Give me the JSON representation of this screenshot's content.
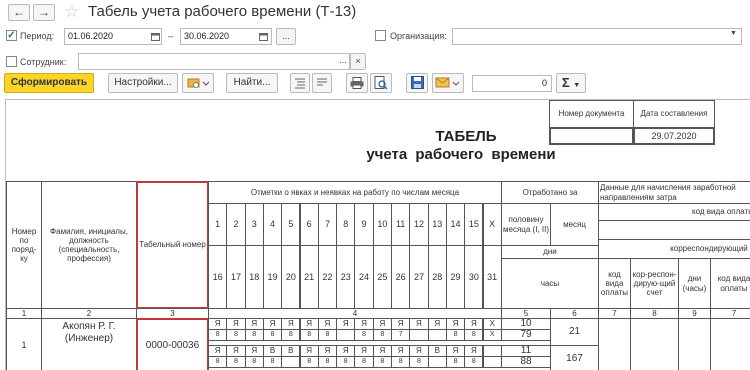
{
  "window": {
    "title": "Табель учета рабочего времени (Т-13)",
    "back_icon": "←",
    "forward_icon": "→",
    "star_icon": "☆"
  },
  "filters": {
    "period_label": "Период:",
    "period_checked": "✓",
    "date_from": "01.06.2020",
    "date_sep": "–",
    "date_to": "30.06.2020",
    "ellipsis": "...",
    "org_label": "Организация:",
    "employees_label": "Сотрудник:",
    "clear_icon": "×"
  },
  "actions": {
    "generate": "Сформировать",
    "settings": "Настройки...",
    "find": "Найти...",
    "counter": "0",
    "sum_icon": "Σ"
  },
  "report": {
    "doc_number_header": "Номер документа",
    "doc_date_header": "Дата составления",
    "doc_date": "29.07.2020",
    "title_line1": "ТАБЕЛЬ",
    "title_line2": "учета рабочего времени",
    "col_num": "Номер по поряд-ку",
    "col_name": "Фамилия, инициалы, должность (специальность, профессия)",
    "col_tab": "Табельный номер",
    "col_marks": "Отметки о явках и неявках на работу по числам месяца",
    "col_worked": "Отработано за",
    "col_half": "половину месяца (I, II)",
    "col_month": "месяц",
    "col_days": "дни",
    "col_hours": "часы",
    "col_pay": "Данные для начисления заработной направлениям затра",
    "col_pay_code": "код вида оплаты",
    "col_corr_acc": "корреспондирующий с",
    "col_code_pay": "код вида оплаты",
    "col_corr_acc2": "кор-респон-дирую-щий счет",
    "col_days_hours": "дни (часы)",
    "col_code_pay2": "код вида оплаты",
    "days_row1": [
      "1",
      "2",
      "3",
      "4",
      "5",
      "6",
      "7",
      "8",
      "9",
      "10",
      "11",
      "12",
      "13",
      "14",
      "15",
      "X"
    ],
    "days_row2": [
      "16",
      "17",
      "18",
      "19",
      "20",
      "21",
      "22",
      "23",
      "24",
      "25",
      "26",
      "27",
      "28",
      "29",
      "30",
      "31"
    ],
    "colnums": [
      "1",
      "2",
      "3",
      "4",
      "5",
      "6",
      "7",
      "8",
      "9",
      "7"
    ],
    "employee": {
      "num": "1",
      "name": "Акопян Р. Г. (Инженер)",
      "tab_no": "0000-00036",
      "marks1": [
        "Я",
        "Я",
        "Я",
        "Я",
        "Я",
        "Я",
        "Я",
        "Я",
        "Я",
        "Я",
        "Я",
        "Я",
        "Я",
        "Я",
        "Я",
        "Х"
      ],
      "hours1": [
        "8",
        "8",
        "8",
        "8",
        "8",
        "8",
        "8",
        "",
        "8",
        "8",
        "7",
        "",
        "",
        "8",
        "8",
        "Х"
      ],
      "marks2": [
        "Я",
        "Я",
        "Я",
        "В",
        "В",
        "Я",
        "Я",
        "Я",
        "Я",
        "Я",
        "Я",
        "Я",
        "В",
        "Я",
        "Я",
        ""
      ],
      "hours2": [
        "8",
        "8",
        "8",
        "8",
        "",
        "8",
        "8",
        "8",
        "8",
        "8",
        "8",
        "8",
        "",
        "8",
        "8",
        ""
      ],
      "half1_days": "10",
      "half1_hours": "79",
      "half2_days": "11",
      "half2_hours": "88",
      "month_days": "21",
      "month_hours": "167"
    }
  }
}
